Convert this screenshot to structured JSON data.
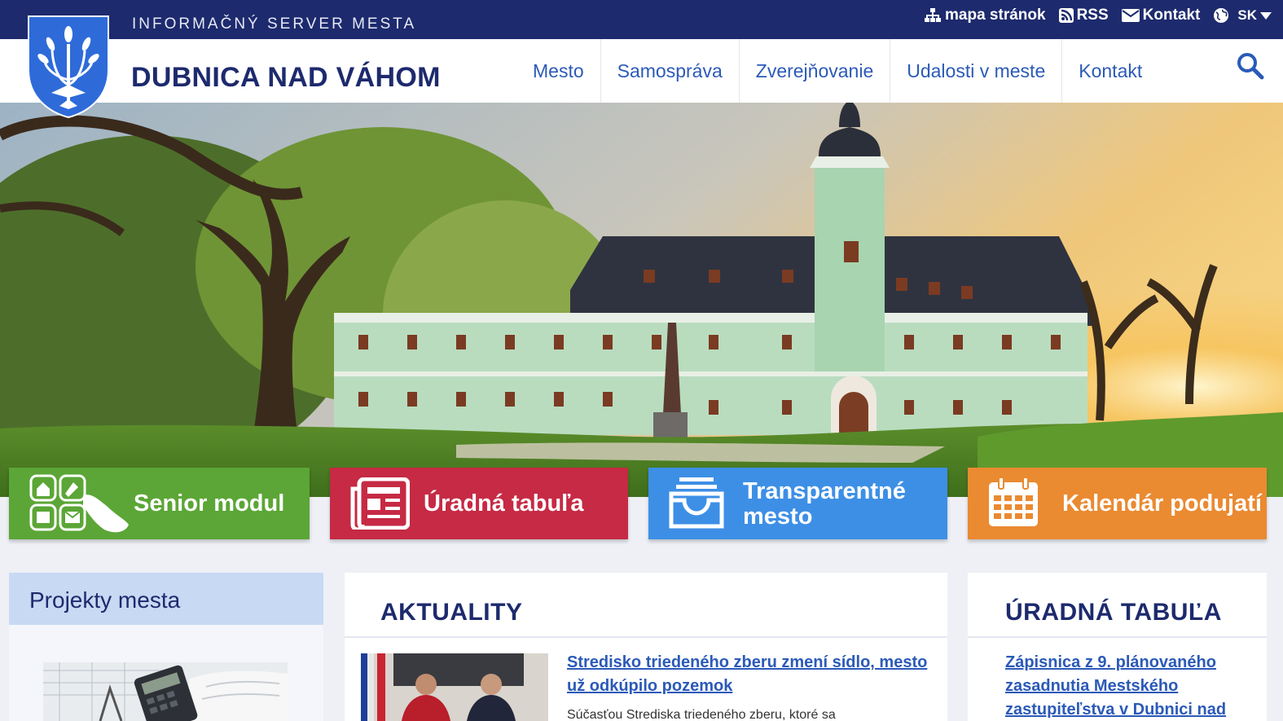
{
  "header": {
    "subtitle": "INFORMAČNÝ SERVER MESTA",
    "title": "DUBNICA NAD VÁHOM",
    "top_links": {
      "sitemap": "mapa stránok",
      "rss": "RSS",
      "contact": "Kontakt",
      "language": "SK"
    },
    "nav": [
      "Mesto",
      "Samospráva",
      "Zverejňovanie",
      "Udalosti v meste",
      "Kontakt"
    ]
  },
  "tiles": [
    {
      "label": "Senior modul",
      "icon": "senior-modul-icon",
      "color": "#5ba636"
    },
    {
      "label": "Úradná tabuľa",
      "icon": "newspaper-icon",
      "color": "#c62a44"
    },
    {
      "label_line1": "Transparentné",
      "label_line2": "mesto",
      "icon": "inbox-tray-icon",
      "color": "#3d8fe6"
    },
    {
      "label": "Kalendár podujatí",
      "icon": "calendar-icon",
      "color": "#ea8a31"
    }
  ],
  "projects": {
    "heading": "Projekty mesta"
  },
  "news": {
    "heading": "AKTUALITY",
    "items": [
      {
        "title_line1": "Stredisko triedeného zberu zmení sídlo, mesto",
        "title_line2": "už odkúpilo pozemok",
        "excerpt": "Súčasťou Strediska triedeného zberu, ktoré sa"
      }
    ]
  },
  "board": {
    "heading": "ÚRADNÁ TABUĽA",
    "items": [
      {
        "line1": "Zápisnica z 9. plánovaného",
        "line2": "zasadnutia Mestského",
        "line3": "zastupiteľstva v Dubnici nad"
      }
    ]
  },
  "colors": {
    "top_bar": "#1d2a6d",
    "nav_link": "#2b5ab8",
    "senior": "#5ba636",
    "board_tile": "#c62a44",
    "transparent": "#3d8fe6",
    "calendar": "#ea8a31"
  }
}
